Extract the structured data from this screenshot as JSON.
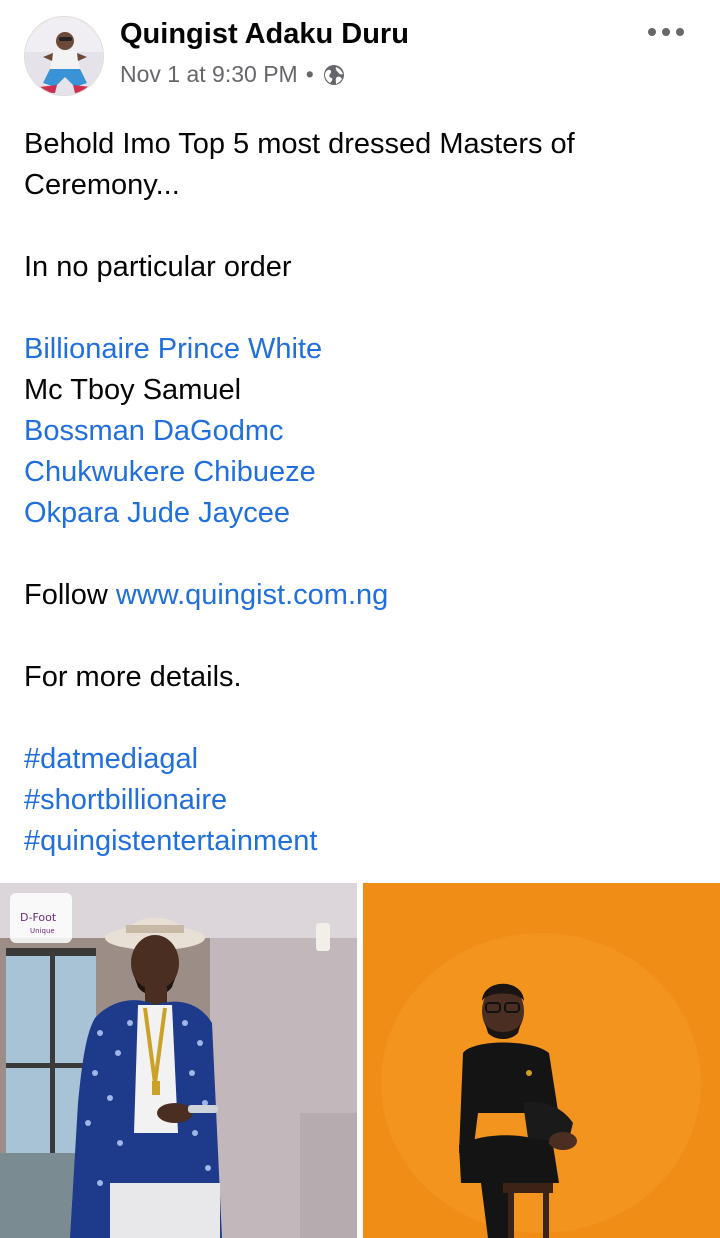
{
  "post": {
    "author": "Quingist Adaku Duru",
    "timestamp": "Nov 1 at 9:30 PM",
    "separator": "•",
    "privacy_icon": "globe-icon",
    "more_icon": "more-options-icon"
  },
  "content": {
    "line1": "Behold Imo Top 5 most dressed Masters of",
    "line2": "Ceremony...",
    "order_note": "In no particular order",
    "names": [
      {
        "text": "Billionaire Prince White",
        "is_link": true
      },
      {
        "text": "Mc Tboy Samuel",
        "is_link": false
      },
      {
        "text": "Bossman DaGodmc",
        "is_link": true
      },
      {
        "text": "Chukwukere Chibueze",
        "is_link": true
      },
      {
        "text": "Okpara Jude Jaycee",
        "is_link": true
      }
    ],
    "follow_label": "Follow",
    "follow_url": "www.quingist.com.ng",
    "details": "For more details.",
    "hashtags": [
      "#datmediagal",
      "#shortbillionaire",
      "#quingistentertainment"
    ]
  },
  "photos": {
    "left_logo_text": "D-Foot",
    "left_logo_sub": "Unique"
  },
  "colors": {
    "link": "#216fdb",
    "text": "#050505",
    "meta": "#65676b",
    "right_photo_bg": "#f08d16"
  }
}
